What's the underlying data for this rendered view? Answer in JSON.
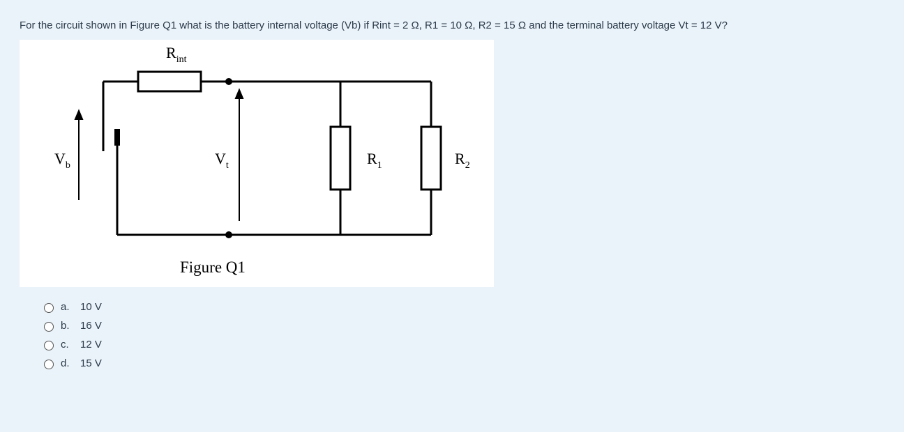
{
  "question": "For the circuit shown in Figure Q1 what is the battery internal voltage (Vb) if Rint = 2 Ω, R1 = 10 Ω, R2 = 15 Ω and the terminal battery voltage Vt = 12 V?",
  "figure": {
    "caption": "Figure Q1",
    "labels": {
      "Rint": "R",
      "Rint_sub": "int",
      "Vb": "V",
      "Vb_sub": "b",
      "Vt": "V",
      "Vt_sub": "t",
      "R1": "R",
      "R1_sub": "1",
      "R2": "R",
      "R2_sub": "2"
    }
  },
  "options": [
    {
      "letter": "a.",
      "label": "10 V"
    },
    {
      "letter": "b.",
      "label": "16 V"
    },
    {
      "letter": "c.",
      "label": "12 V"
    },
    {
      "letter": "d.",
      "label": "15 V"
    }
  ]
}
